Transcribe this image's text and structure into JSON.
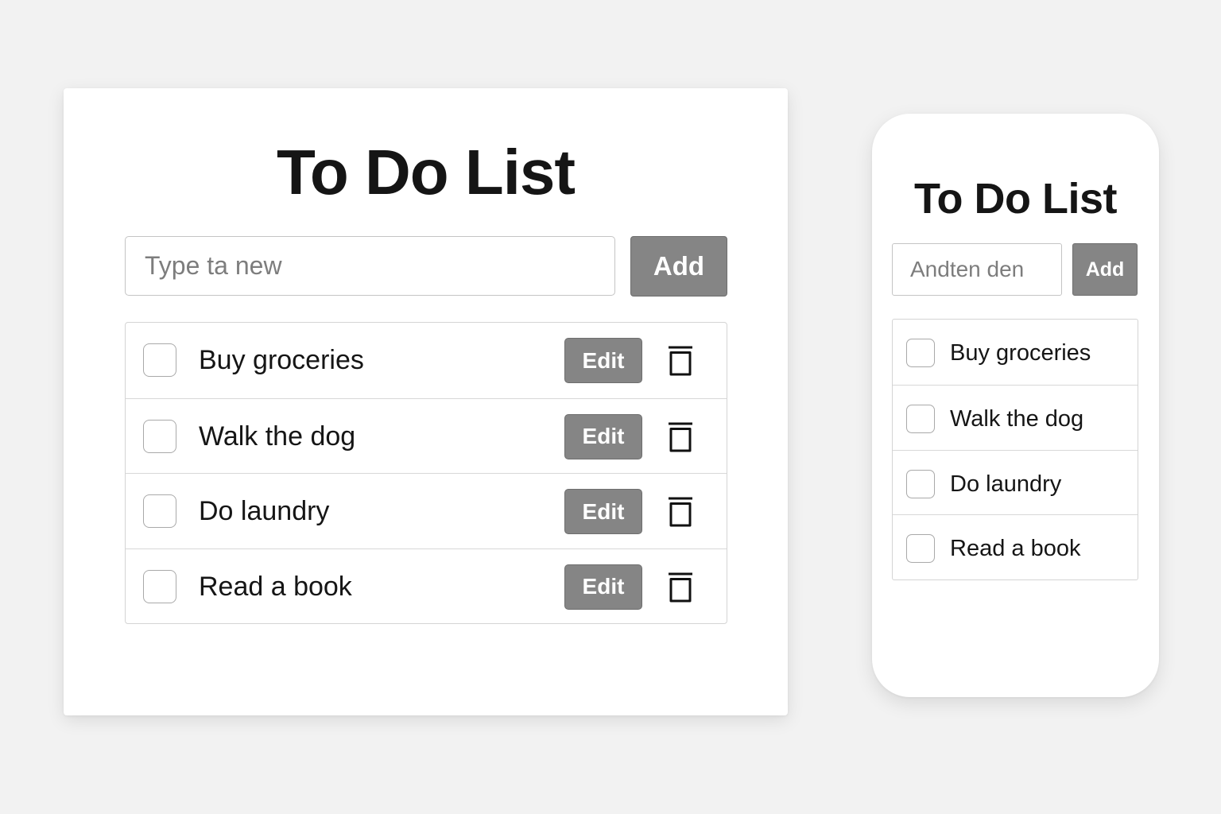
{
  "colors": {
    "background": "#f2f2f2",
    "card": "#ffffff",
    "button": "#858585",
    "button_text": "#ffffff",
    "text": "#151515",
    "placeholder": "#7d7d7d"
  },
  "desktop": {
    "title": "To Do List",
    "input": {
      "placeholder": "Type ta new",
      "value": ""
    },
    "add_label": "Add",
    "tasks": [
      {
        "label": "Buy groceries",
        "checked": false,
        "edit_label": "Edit",
        "delete_icon": "trash-icon"
      },
      {
        "label": "Walk the dog",
        "checked": false,
        "edit_label": "Edit",
        "delete_icon": "trash-icon"
      },
      {
        "label": "Do laundry",
        "checked": false,
        "edit_label": "Edit",
        "delete_icon": "trash-icon"
      },
      {
        "label": "Read a book",
        "checked": false,
        "edit_label": "Edit",
        "delete_icon": "trash-icon"
      }
    ]
  },
  "mobile": {
    "title": "To Do List",
    "input": {
      "placeholder": "Andten den",
      "value": ""
    },
    "add_label": "Add",
    "tasks": [
      {
        "label": "Buy groceries",
        "checked": false
      },
      {
        "label": "Walk the dog",
        "checked": false
      },
      {
        "label": "Do laundry",
        "checked": false
      },
      {
        "label": "Read a book",
        "checked": false
      }
    ]
  }
}
